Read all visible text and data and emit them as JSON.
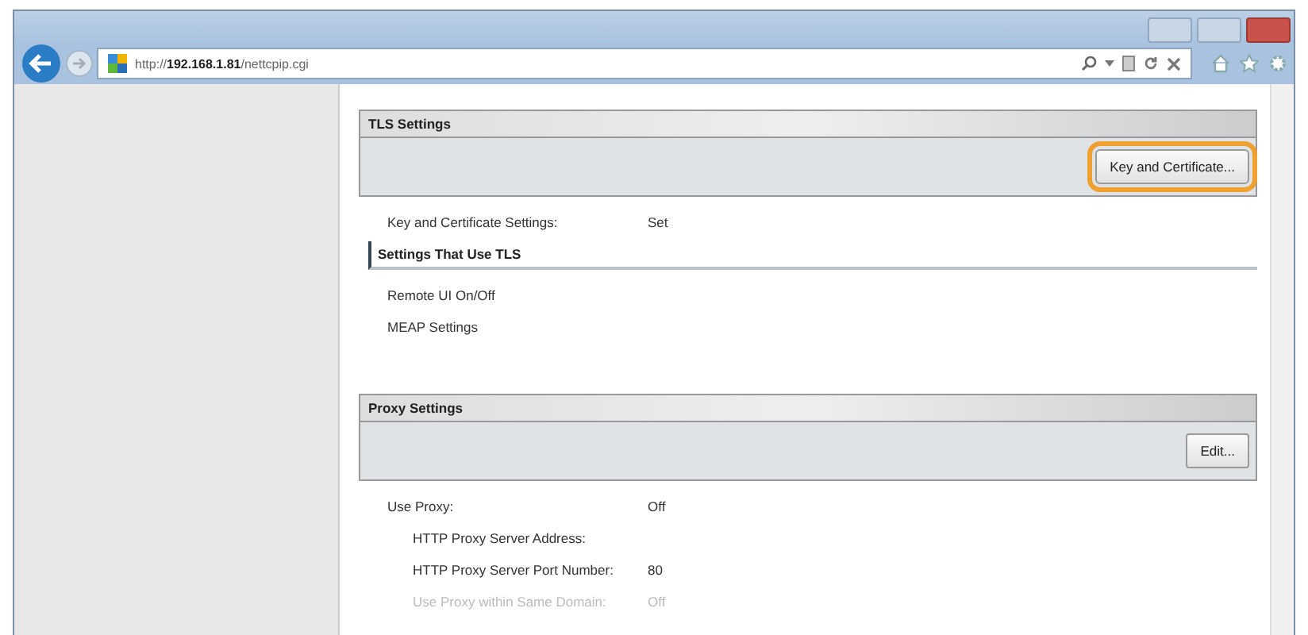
{
  "browser": {
    "url": "http://**192.168.1.81**/nettcpip.cgi"
  },
  "tls_panel": {
    "title": "TLS Settings",
    "button": {
      "label": "Key and Certificate...",
      "highlighted": true
    },
    "rows": [
      {
        "label": "Key and Certificate Settings:",
        "value": "Set"
      }
    ],
    "subsection": {
      "title": "Settings That Use TLS",
      "items": [
        "Remote UI On/Off",
        "MEAP Settings"
      ]
    }
  },
  "proxy_panel": {
    "title": "Proxy Settings",
    "button": {
      "label": "Edit...",
      "highlighted": false
    },
    "rows": [
      {
        "label": "Use Proxy:",
        "value": "Off",
        "indented": false,
        "dimmed": false
      },
      {
        "label": "HTTP Proxy Server Address:",
        "value": "",
        "indented": true,
        "dimmed": false
      },
      {
        "label": "HTTP Proxy Server Port Number:",
        "value": "80",
        "indented": true,
        "dimmed": false
      },
      {
        "label": "Use Proxy within Same Domain:",
        "value": "Off",
        "indented": true,
        "dimmed": true
      }
    ]
  }
}
